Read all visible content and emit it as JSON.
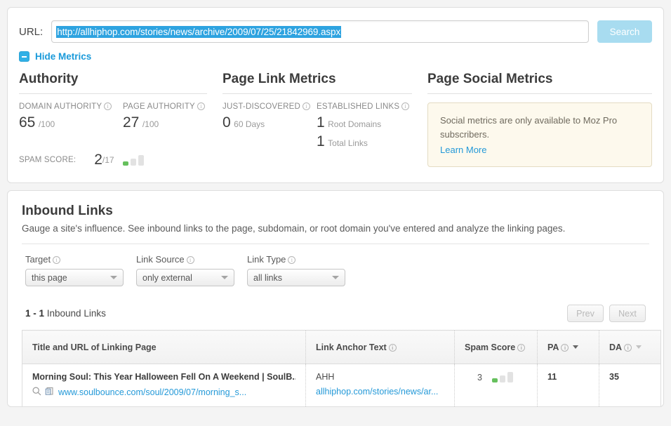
{
  "search": {
    "url_label": "URL:",
    "url_value": "http://allhiphop.com/stories/news/archive/2009/07/25/21842969.aspx",
    "search_button": "Search"
  },
  "hide_metrics": {
    "label": "Hide Metrics"
  },
  "authority": {
    "title": "Authority",
    "domain_authority": {
      "label": "DOMAIN AUTHORITY",
      "value": "65",
      "unit": "/100"
    },
    "page_authority": {
      "label": "PAGE AUTHORITY",
      "value": "27",
      "unit": "/100"
    },
    "spam_score": {
      "label": "SPAM SCORE:",
      "value": "2",
      "unit": "/17"
    }
  },
  "page_link_metrics": {
    "title": "Page Link Metrics",
    "just_discovered": {
      "label": "JUST-DISCOVERED",
      "value": "0",
      "unit": "60 Days"
    },
    "established_links": {
      "label": "ESTABLISHED LINKS",
      "root_domains_value": "1",
      "root_domains_unit": "Root Domains",
      "total_links_value": "1",
      "total_links_unit": "Total Links"
    }
  },
  "page_social_metrics": {
    "title": "Page Social Metrics",
    "notice": "Social metrics are only available to Moz Pro subscribers.",
    "learn_more": "Learn More"
  },
  "inbound_links": {
    "title": "Inbound Links",
    "description": "Gauge a site's influence. See inbound links to the page, subdomain, or root domain you've entered and analyze the linking pages.",
    "filters": [
      {
        "label": "Target",
        "value": "this page"
      },
      {
        "label": "Link Source",
        "value": "only external"
      },
      {
        "label": "Link Type",
        "value": "all links"
      }
    ],
    "count_text": "1 - 1",
    "count_suffix": " Inbound Links",
    "prev_button": "Prev",
    "next_button": "Next",
    "columns": [
      {
        "label": "Title and URL of Linking Page",
        "info": false
      },
      {
        "label": "Link Anchor Text",
        "info": true
      },
      {
        "label": "Spam Score",
        "info": true
      },
      {
        "label": "PA",
        "info": true
      },
      {
        "label": "DA",
        "info": true
      }
    ],
    "rows": [
      {
        "title": "Morning Soul: This Year Halloween Fell On A Weekend | SoulB...",
        "url": "www.soulbounce.com/soul/2009/07/morning_s...",
        "anchor_text": "AHH",
        "anchor_url": "allhiphop.com/stories/news/ar...",
        "spam_score": "3",
        "pa": "11",
        "da": "35"
      }
    ]
  },
  "colors": {
    "accent_blue": "#2499d8",
    "selection_blue": "#2ea3e0",
    "toggle_blue": "#31b0e6",
    "spam_green": "#66c05d",
    "notice_bg": "#fdf9ed"
  }
}
